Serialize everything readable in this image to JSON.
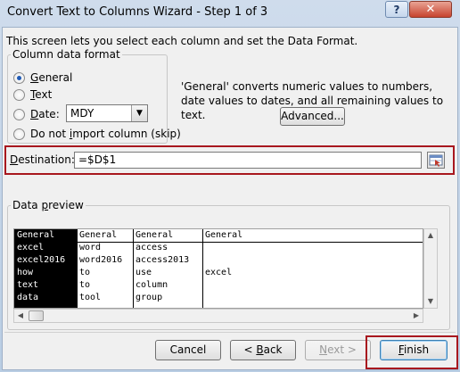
{
  "window": {
    "title": "Convert Text to Columns Wizard - Step 1 of 3",
    "help_label": "?",
    "close_label": "✕"
  },
  "intro": "This screen lets you select each column and set the Data Format.",
  "column_format": {
    "legend": "Column data format",
    "options": [
      {
        "label": "General",
        "key": "G",
        "selected": true
      },
      {
        "label": "Text",
        "key": "T",
        "selected": false
      },
      {
        "label": "Date:",
        "key": "D",
        "selected": false
      },
      {
        "label": "Do not import column (skip)",
        "key": "I",
        "selected": false
      }
    ],
    "date_format": "MDY"
  },
  "description": "'General' converts numeric values to numbers, date values to dates, and all remaining values to text.",
  "advanced_label": "Advanced...",
  "destination": {
    "label": "Destination:",
    "value": "=$D$1"
  },
  "preview": {
    "legend": "Data preview",
    "headers": [
      "General",
      "General",
      "General",
      "General"
    ],
    "rows": [
      [
        "excel",
        "word",
        "access",
        ""
      ],
      [
        "excel2016",
        "word2016",
        "access2013",
        ""
      ],
      [
        "how",
        "to",
        "use",
        "excel"
      ],
      [
        "text",
        "to",
        "column",
        ""
      ],
      [
        "data",
        "tool",
        "group",
        ""
      ]
    ]
  },
  "buttons": {
    "cancel": "Cancel",
    "back": "< Back",
    "next": "Next >",
    "finish": "Finish"
  },
  "colors": {
    "highlight_border": "#a8171e",
    "selected_column_bg": "#000000"
  }
}
